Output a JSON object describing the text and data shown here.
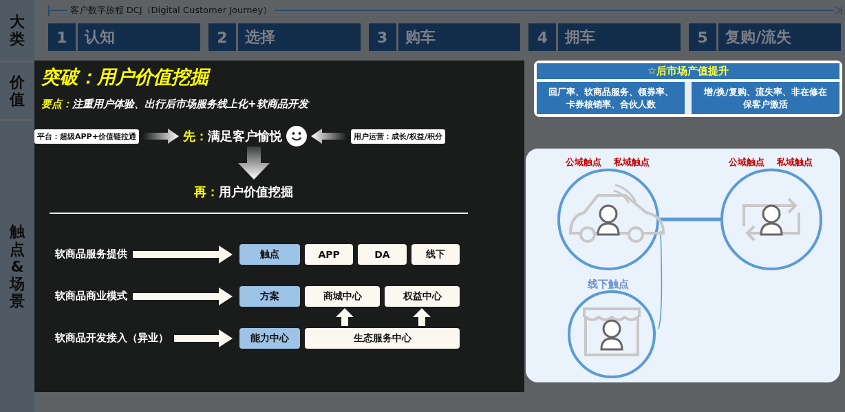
{
  "side_labels": [
    {
      "text": "大类"
    },
    {
      "text": "价值"
    },
    {
      "text": "触点&场景"
    }
  ],
  "journey": {
    "title": "客户数字旅程  DCJ（Digital Customer Journey）",
    "stages": [
      {
        "number": "1",
        "name": "认知"
      },
      {
        "number": "2",
        "name": "选择"
      },
      {
        "number": "3",
        "name": "购车"
      },
      {
        "number": "4",
        "name": "拥车"
      },
      {
        "number": "5",
        "name": "复购/流失"
      }
    ]
  },
  "aftermarket": {
    "title": "☆后市场产值提升",
    "metrics": [
      "回厂率、软商品服务、领券率、卡券核销率、合伙人数",
      "增/换/复购、流失率、非在修在保客户激活"
    ]
  },
  "touchpoints": {
    "rings": [
      {
        "public_label": "公域触点",
        "private_label": "私域触点",
        "kind": "car"
      },
      {
        "public_label": "公域触点",
        "private_label": "私域触点",
        "kind": "cycle"
      },
      {
        "offline_label": "线下触点",
        "kind": "store"
      }
    ]
  },
  "overlay": {
    "headline": "突破：用户价值挖掘",
    "key_label": "要点：",
    "key_text": "注重用户体验、出行后市场服务线上化+软商品开发",
    "platform_tag": "平台：超级APP+价值链拉通",
    "first_label": "先：",
    "first_text": "满足客户愉悦",
    "operation_tag": "用户运营：成长/权益/积分",
    "then_label": "再：",
    "then_text": "用户价值挖掘",
    "rows": [
      {
        "label": "软商品服务提供",
        "boxes": [
          {
            "text": "触点",
            "highlighted": true
          },
          {
            "text": "APP",
            "highlighted": false
          },
          {
            "text": "DA",
            "highlighted": false
          },
          {
            "text": "线下",
            "highlighted": false
          }
        ]
      },
      {
        "label": "软商品商业模式",
        "boxes": [
          {
            "text": "方案",
            "highlighted": true
          },
          {
            "text": "商城中心",
            "highlighted": false
          },
          {
            "text": "权益中心",
            "highlighted": false
          }
        ]
      },
      {
        "label": "软商品开发接入（异业）",
        "boxes": [
          {
            "text": "能力中心",
            "highlighted": true
          },
          {
            "text": "生态服务中心",
            "highlighted": false
          }
        ]
      }
    ]
  }
}
